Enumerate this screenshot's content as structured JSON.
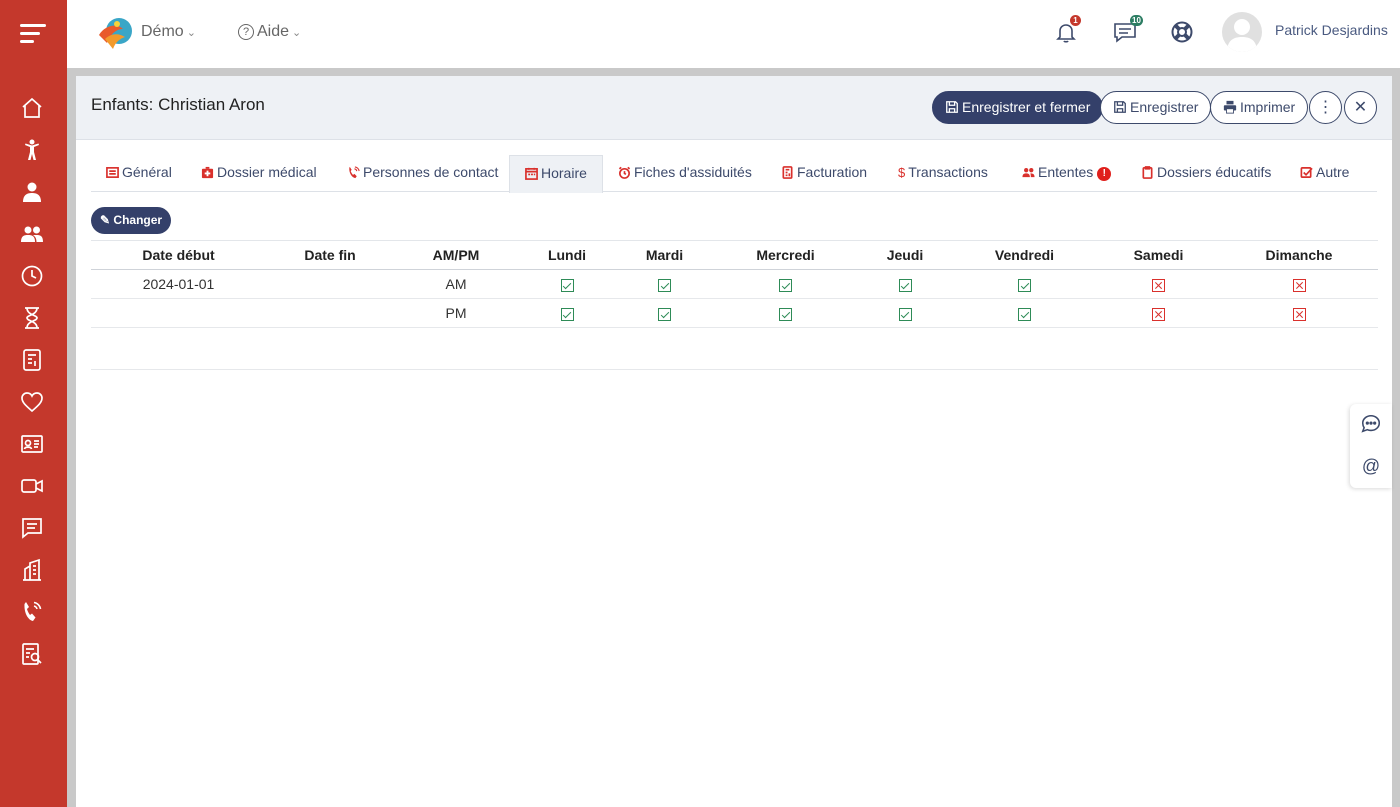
{
  "topbar": {
    "org_label": "Démo",
    "help_label": "Aide",
    "notifications_count": "1",
    "messages_count": "10",
    "user_name": "Patrick Desjardins"
  },
  "sidebar": {
    "items": [
      "home-icon",
      "child-icon",
      "person-icon",
      "group-icon",
      "clock-icon",
      "hourglass-icon",
      "billing-icon",
      "heart-icon",
      "id-card-icon",
      "video-icon",
      "message-icon",
      "building-icon",
      "phone-icon",
      "report-icon"
    ]
  },
  "modal": {
    "title": "Enfants: Christian Aron",
    "save_close_label": "Enregistrer et fermer",
    "save_label": "Enregistrer",
    "print_label": "Imprimer"
  },
  "tabs": [
    {
      "label": "Général"
    },
    {
      "label": "Dossier médical"
    },
    {
      "label": "Personnes de contact"
    },
    {
      "label": "Horaire"
    },
    {
      "label": "Fiches d'assiduités"
    },
    {
      "label": "Facturation"
    },
    {
      "label": "Transactions"
    },
    {
      "label": "Ententes"
    },
    {
      "label": "Dossiers éducatifs"
    },
    {
      "label": "Autre"
    }
  ],
  "active_tab": "Horaire",
  "change_label": "Changer",
  "schedule": {
    "headers": [
      "Date début",
      "Date fin",
      "AM/PM",
      "Lundi",
      "Mardi",
      "Mercredi",
      "Jeudi",
      "Vendredi",
      "Samedi",
      "Dimanche"
    ],
    "rows": [
      {
        "start": "2024-01-01",
        "end": "",
        "period": "AM",
        "days": [
          true,
          true,
          true,
          true,
          true,
          false,
          false
        ]
      },
      {
        "start": "",
        "end": "",
        "period": "PM",
        "days": [
          true,
          true,
          true,
          true,
          true,
          false,
          false
        ]
      }
    ]
  },
  "colors": {
    "sidebar": "#c4382c",
    "primary": "#34406a",
    "check": "#2e8b57",
    "cross": "#d9302c"
  }
}
